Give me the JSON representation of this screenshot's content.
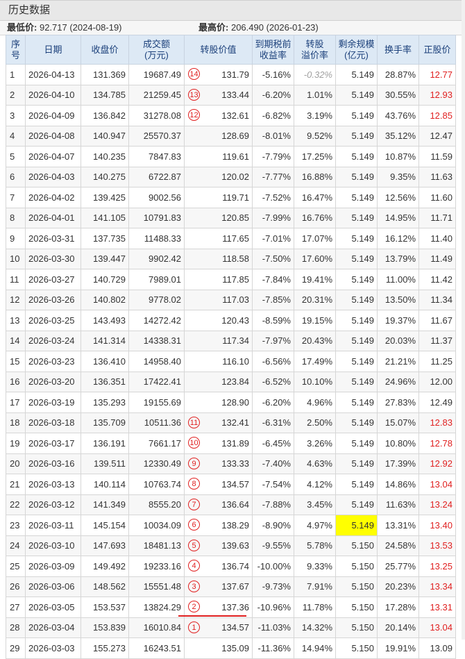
{
  "title": "历史数据",
  "summary": {
    "min_label": "最低价:",
    "min_value": "92.717 (2024-08-19)",
    "max_label": "最高价:",
    "max_value": "206.490 (2026-01-23)"
  },
  "headers": [
    "序号",
    "日期",
    "收盘价",
    "成交额(万元)",
    "转股价值",
    "到期税前收益率",
    "转股溢价率",
    "剩余规模(亿元)",
    "换手率",
    "正股价"
  ],
  "header_lines": [
    [
      "序",
      "号"
    ],
    [
      "日期"
    ],
    [
      "收盘价"
    ],
    [
      "成交额",
      "(万元)"
    ],
    [
      "转股价值"
    ],
    [
      "到期税前",
      "收益率"
    ],
    [
      "转股",
      "溢价率"
    ],
    [
      "剩余规模",
      "(亿元)"
    ],
    [
      "换手率"
    ],
    [
      "正股价"
    ]
  ],
  "colors": {
    "accent_red": "#e02020",
    "header_bg": "#dde9f5",
    "highlight": "#ffff00"
  },
  "rows": [
    {
      "seq": "1",
      "date": "2026-04-13",
      "close": "131.369",
      "amount": "19687.49",
      "mark": "14",
      "conv": "131.79",
      "ytm": "-5.16%",
      "premium": "-0.32%",
      "remain": "5.149",
      "turnover": "28.87%",
      "stock": "12.77",
      "stock_red": true,
      "premium_grey": true
    },
    {
      "seq": "2",
      "date": "2026-04-10",
      "close": "134.785",
      "amount": "21259.45",
      "mark": "13",
      "conv": "133.44",
      "ytm": "-6.20%",
      "premium": "1.01%",
      "remain": "5.149",
      "turnover": "30.55%",
      "stock": "12.93",
      "stock_red": true
    },
    {
      "seq": "3",
      "date": "2026-04-09",
      "close": "136.842",
      "amount": "31278.08",
      "mark": "12",
      "conv": "132.61",
      "ytm": "-6.82%",
      "premium": "3.19%",
      "remain": "5.149",
      "turnover": "43.76%",
      "stock": "12.85",
      "stock_red": true
    },
    {
      "seq": "4",
      "date": "2026-04-08",
      "close": "140.947",
      "amount": "25570.37",
      "mark": "",
      "conv": "128.69",
      "ytm": "-8.01%",
      "premium": "9.52%",
      "remain": "5.149",
      "turnover": "35.12%",
      "stock": "12.47"
    },
    {
      "seq": "5",
      "date": "2026-04-07",
      "close": "140.235",
      "amount": "7847.83",
      "mark": "",
      "conv": "119.61",
      "ytm": "-7.79%",
      "premium": "17.25%",
      "remain": "5.149",
      "turnover": "10.87%",
      "stock": "11.59"
    },
    {
      "seq": "6",
      "date": "2026-04-03",
      "close": "140.275",
      "amount": "6722.87",
      "mark": "",
      "conv": "120.02",
      "ytm": "-7.77%",
      "premium": "16.88%",
      "remain": "5.149",
      "turnover": "9.35%",
      "stock": "11.63"
    },
    {
      "seq": "7",
      "date": "2026-04-02",
      "close": "139.425",
      "amount": "9002.56",
      "mark": "",
      "conv": "119.71",
      "ytm": "-7.52%",
      "premium": "16.47%",
      "remain": "5.149",
      "turnover": "12.56%",
      "stock": "11.60"
    },
    {
      "seq": "8",
      "date": "2026-04-01",
      "close": "141.105",
      "amount": "10791.83",
      "mark": "",
      "conv": "120.85",
      "ytm": "-7.99%",
      "premium": "16.76%",
      "remain": "5.149",
      "turnover": "14.95%",
      "stock": "11.71"
    },
    {
      "seq": "9",
      "date": "2026-03-31",
      "close": "137.735",
      "amount": "11488.33",
      "mark": "",
      "conv": "117.65",
      "ytm": "-7.01%",
      "premium": "17.07%",
      "remain": "5.149",
      "turnover": "16.12%",
      "stock": "11.40"
    },
    {
      "seq": "10",
      "date": "2026-03-30",
      "close": "139.447",
      "amount": "9902.42",
      "mark": "",
      "conv": "118.58",
      "ytm": "-7.50%",
      "premium": "17.60%",
      "remain": "5.149",
      "turnover": "13.79%",
      "stock": "11.49"
    },
    {
      "seq": "11",
      "date": "2026-03-27",
      "close": "140.729",
      "amount": "7989.01",
      "mark": "",
      "conv": "117.85",
      "ytm": "-7.84%",
      "premium": "19.41%",
      "remain": "5.149",
      "turnover": "11.00%",
      "stock": "11.42"
    },
    {
      "seq": "12",
      "date": "2026-03-26",
      "close": "140.802",
      "amount": "9778.02",
      "mark": "",
      "conv": "117.03",
      "ytm": "-7.85%",
      "premium": "20.31%",
      "remain": "5.149",
      "turnover": "13.50%",
      "stock": "11.34"
    },
    {
      "seq": "13",
      "date": "2026-03-25",
      "close": "143.493",
      "amount": "14272.42",
      "mark": "",
      "conv": "120.43",
      "ytm": "-8.59%",
      "premium": "19.15%",
      "remain": "5.149",
      "turnover": "19.37%",
      "stock": "11.67"
    },
    {
      "seq": "14",
      "date": "2026-03-24",
      "close": "141.314",
      "amount": "14338.31",
      "mark": "",
      "conv": "117.34",
      "ytm": "-7.97%",
      "premium": "20.43%",
      "remain": "5.149",
      "turnover": "20.03%",
      "stock": "11.37"
    },
    {
      "seq": "15",
      "date": "2026-03-23",
      "close": "136.410",
      "amount": "14958.40",
      "mark": "",
      "conv": "116.10",
      "ytm": "-6.56%",
      "premium": "17.49%",
      "remain": "5.149",
      "turnover": "21.21%",
      "stock": "11.25"
    },
    {
      "seq": "16",
      "date": "2026-03-20",
      "close": "136.351",
      "amount": "17422.41",
      "mark": "",
      "conv": "123.84",
      "ytm": "-6.52%",
      "premium": "10.10%",
      "remain": "5.149",
      "turnover": "24.96%",
      "stock": "12.00"
    },
    {
      "seq": "17",
      "date": "2026-03-19",
      "close": "135.293",
      "amount": "19155.69",
      "mark": "",
      "conv": "128.90",
      "ytm": "-6.20%",
      "premium": "4.96%",
      "remain": "5.149",
      "turnover": "27.83%",
      "stock": "12.49"
    },
    {
      "seq": "18",
      "date": "2026-03-18",
      "close": "135.709",
      "amount": "10511.36",
      "mark": "11",
      "conv": "132.41",
      "ytm": "-6.31%",
      "premium": "2.50%",
      "remain": "5.149",
      "turnover": "15.07%",
      "stock": "12.83",
      "stock_red": true
    },
    {
      "seq": "19",
      "date": "2026-03-17",
      "close": "136.191",
      "amount": "7661.17",
      "mark": "10",
      "conv": "131.89",
      "ytm": "-6.45%",
      "premium": "3.26%",
      "remain": "5.149",
      "turnover": "10.80%",
      "stock": "12.78",
      "stock_red": true
    },
    {
      "seq": "20",
      "date": "2026-03-16",
      "close": "139.511",
      "amount": "12330.49",
      "mark": "9",
      "conv": "133.33",
      "ytm": "-7.40%",
      "premium": "4.63%",
      "remain": "5.149",
      "turnover": "17.39%",
      "stock": "12.92",
      "stock_red": true
    },
    {
      "seq": "21",
      "date": "2026-03-13",
      "close": "140.114",
      "amount": "10763.74",
      "mark": "8",
      "conv": "134.57",
      "ytm": "-7.54%",
      "premium": "4.12%",
      "remain": "5.149",
      "turnover": "14.86%",
      "stock": "13.04",
      "stock_red": true
    },
    {
      "seq": "22",
      "date": "2026-03-12",
      "close": "141.349",
      "amount": "8555.20",
      "mark": "7",
      "conv": "136.64",
      "ytm": "-7.88%",
      "premium": "3.45%",
      "remain": "5.149",
      "turnover": "11.63%",
      "stock": "13.24",
      "stock_red": true
    },
    {
      "seq": "23",
      "date": "2026-03-11",
      "close": "145.154",
      "amount": "10034.09",
      "mark": "6",
      "conv": "138.29",
      "ytm": "-8.90%",
      "premium": "4.97%",
      "remain": "5.149",
      "turnover": "13.31%",
      "stock": "13.40",
      "stock_red": true,
      "remain_hl": true
    },
    {
      "seq": "24",
      "date": "2026-03-10",
      "close": "147.693",
      "amount": "18481.13",
      "mark": "5",
      "conv": "139.63",
      "ytm": "-9.55%",
      "premium": "5.78%",
      "remain": "5.150",
      "turnover": "24.58%",
      "stock": "13.53",
      "stock_red": true
    },
    {
      "seq": "25",
      "date": "2026-03-09",
      "close": "149.492",
      "amount": "19233.16",
      "mark": "4",
      "conv": "136.74",
      "ytm": "-10.00%",
      "premium": "9.33%",
      "remain": "5.150",
      "turnover": "25.77%",
      "stock": "13.25",
      "stock_red": true
    },
    {
      "seq": "26",
      "date": "2026-03-06",
      "close": "148.562",
      "amount": "15551.48",
      "mark": "3",
      "conv": "137.67",
      "ytm": "-9.73%",
      "premium": "7.91%",
      "remain": "5.150",
      "turnover": "20.23%",
      "stock": "13.34",
      "stock_red": true
    },
    {
      "seq": "27",
      "date": "2026-03-05",
      "close": "153.537",
      "amount": "13824.29",
      "mark": "2",
      "conv": "137.36",
      "ytm": "-10.96%",
      "premium": "11.78%",
      "remain": "5.150",
      "turnover": "17.28%",
      "stock": "13.31",
      "stock_red": true
    },
    {
      "seq": "28",
      "date": "2026-03-04",
      "close": "153.839",
      "amount": "16010.84",
      "mark": "1",
      "conv": "134.57",
      "ytm": "-11.03%",
      "premium": "14.32%",
      "remain": "5.150",
      "turnover": "20.14%",
      "stock": "13.04",
      "stock_red": true
    },
    {
      "seq": "29",
      "date": "2026-03-03",
      "close": "155.273",
      "amount": "16243.51",
      "mark": "",
      "conv": "135.09",
      "ytm": "-11.36%",
      "premium": "14.94%",
      "remain": "5.150",
      "turnover": "19.91%",
      "stock": "13.09"
    }
  ]
}
